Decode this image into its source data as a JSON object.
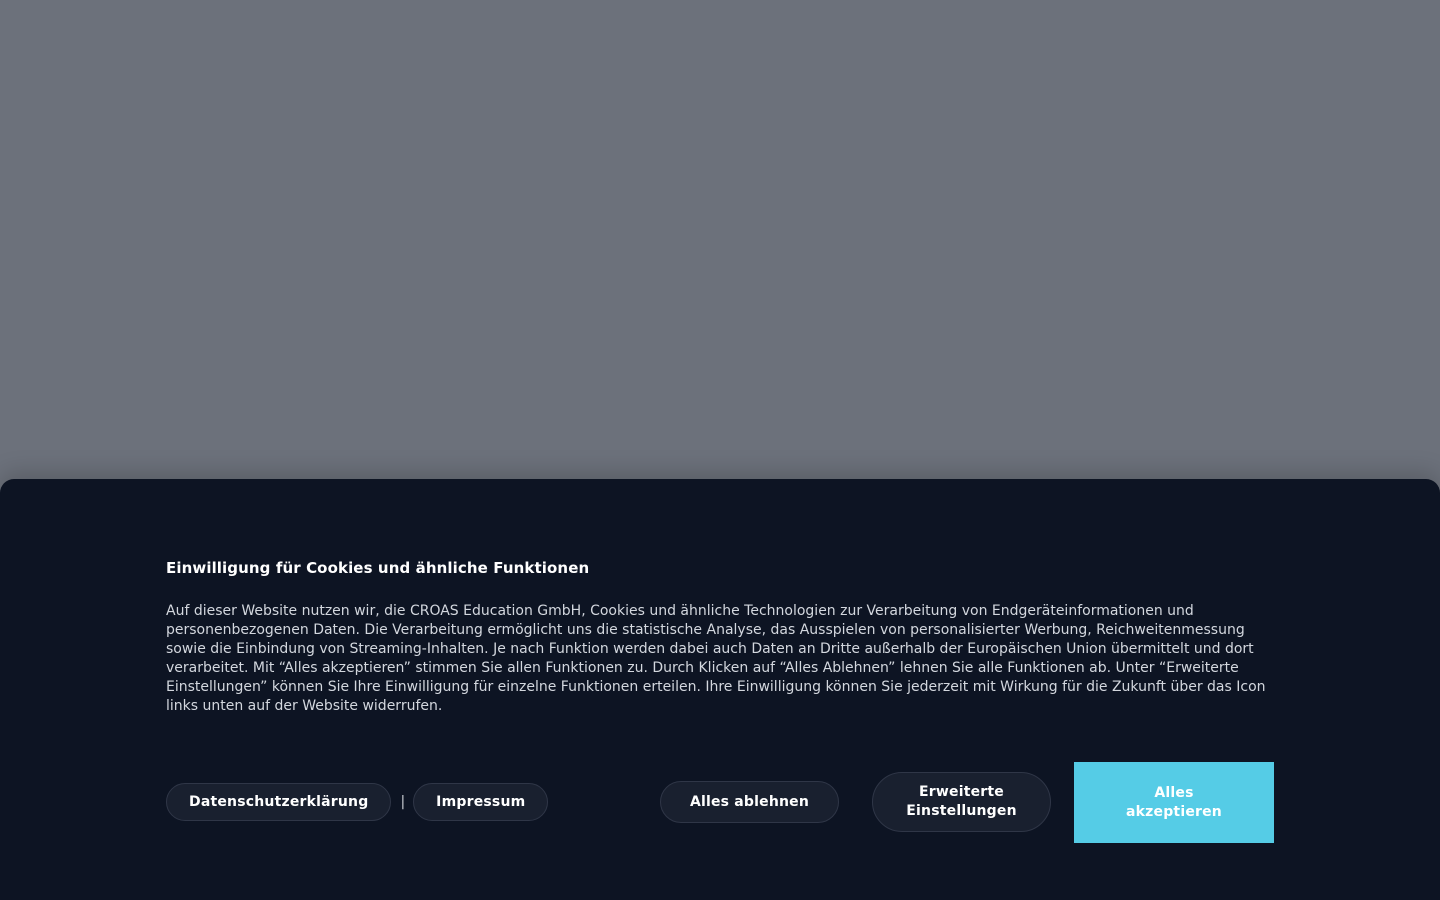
{
  "cookie_banner": {
    "title": "Einwilligung für Cookies und ähnliche Funktionen",
    "description": "Auf dieser Website nutzen wir, die CROAS Education GmbH, Cookies und ähnliche Technologien zur Verarbeitung von Endgeräteinformationen und personenbezogenen Daten. Die Verarbeitung ermöglicht uns die statistische Analyse, das Ausspielen von personalisierter Werbung, Reichweitenmessung sowie die Einbindung von Streaming-Inhalten. Je nach Funktion werden dabei auch Daten an Dritte außerhalb der Europäischen Union übermittelt und dort verarbeitet. Mit “Alles akzeptieren” stimmen Sie allen Funktionen zu. Durch Klicken auf “Alles Ablehnen” lehnen Sie alle Funktionen ab. Unter “Erweiterte Einstellungen” können Sie Ihre Einwilligung für einzelne Funktionen erteilen. Ihre Einwilligung können Sie jederzeit mit Wirkung für die Zukunft über das Icon links unten auf der Website widerrufen.",
    "links": {
      "privacy_label": "Datenschutzerklärung",
      "separator": "|",
      "imprint_label": "Impressum"
    },
    "buttons": {
      "reject_label": "Alles ablehnen",
      "settings_label": "Erweiterte Einstellungen",
      "accept_label": "Alles akzeptieren"
    }
  },
  "colors": {
    "overlay": "#6c717b",
    "banner_background": "#0d1423",
    "button_background": "#19202f",
    "accent": "#55cce6"
  }
}
